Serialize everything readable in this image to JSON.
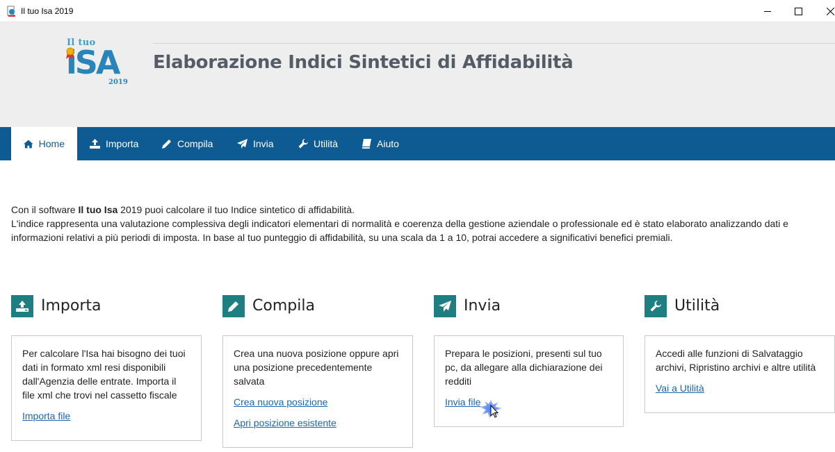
{
  "window": {
    "title": "Il tuo Isa 2019"
  },
  "logo": {
    "line1": "Il tuo",
    "line2": "iSA",
    "year": "2019"
  },
  "header": {
    "title": "Elaborazione Indici Sintetici di Affidabilità"
  },
  "nav": [
    {
      "label": "Home",
      "icon": "home-icon",
      "active": true
    },
    {
      "label": "Importa",
      "icon": "upload-icon"
    },
    {
      "label": "Compila",
      "icon": "pencil-icon"
    },
    {
      "label": "Invia",
      "icon": "paper-plane-icon"
    },
    {
      "label": "Utilità",
      "icon": "wrench-icon"
    },
    {
      "label": "Aiuto",
      "icon": "book-icon"
    }
  ],
  "intro": {
    "line1_pre": "Con il software ",
    "line1_bold": "Il tuo Isa",
    "line1_post": " 2019 puoi calcolare il tuo Indice sintetico di affidabilità.",
    "line2": "L'indice rappresenta una valutazione complessiva degli indicatori elementari di normalità e coerenza della gestione aziendale o professionale ed è stato elaborato analizzando dati e informazioni relativi a più periodi di imposta. In base al tuo punteggio di affidabilità, su una scala da 1 a 10, potrai accedere a significativi benefici premiali."
  },
  "sections": {
    "importa": {
      "title": "Importa",
      "text": "Per calcolare l'Isa hai bisogno dei tuoi dati in formato xml resi disponibili dall'Agenzia delle entrate. Importa il file xml che trovi nel cassetto fiscale",
      "link1": "Importa file"
    },
    "compila": {
      "title": "Compila",
      "text": "Crea una nuova posizione oppure apri una posizione precedentemente salvata",
      "link1": "Crea nuova posizione",
      "link2": "Apri posizione esistente"
    },
    "invia": {
      "title": "Invia",
      "text": "Prepara le posizioni, presenti sul tuo pc, da allegare alla dichiarazione dei redditi",
      "link1": "Invia file"
    },
    "utilita": {
      "title": "Utilità",
      "text": "Accedi alle funzioni di Salvataggio archivi, Ripristino archivi e altre utilità",
      "link1": "Vai a Utilità"
    }
  },
  "colors": {
    "nav_bg": "#0e5b93",
    "section_icon_bg": "#1d7f82",
    "link": "#1a66b0",
    "header_bg": "#eeeeee"
  }
}
